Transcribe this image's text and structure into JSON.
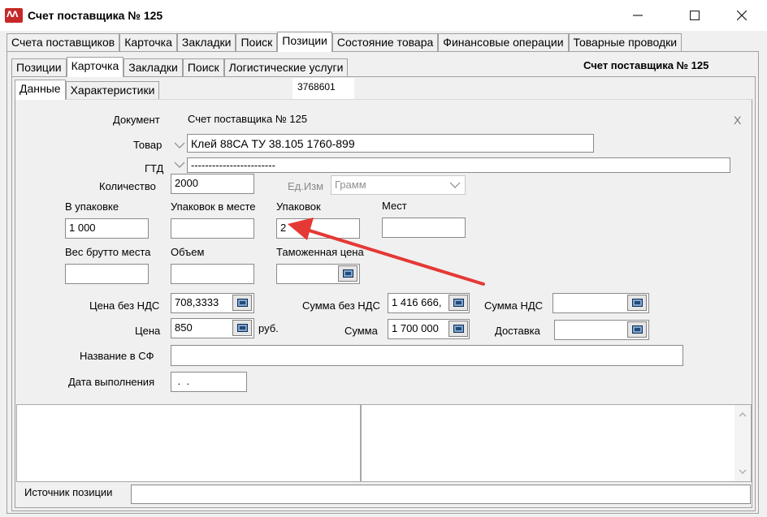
{
  "window": {
    "title": "Счет поставщика № 125",
    "icon_name": "app-logo-icon",
    "controls": [
      "minimize-icon",
      "maximize-icon",
      "close-icon"
    ]
  },
  "main_tabs": [
    {
      "label": "Счета поставщиков"
    },
    {
      "label": "Карточка"
    },
    {
      "label": "Закладки"
    },
    {
      "label": "Поиск"
    },
    {
      "label": "Позиции",
      "active": true
    },
    {
      "label": "Состояние товара"
    },
    {
      "label": "Финансовые операции"
    },
    {
      "label": "Товарные проводки"
    }
  ],
  "sub_tabs": [
    {
      "label": "Позиции"
    },
    {
      "label": "Карточка",
      "active": true
    },
    {
      "label": "Закладки"
    },
    {
      "label": "Поиск"
    },
    {
      "label": "Логистические услуги"
    }
  ],
  "header_doc": "Счет поставщика № 125",
  "inner_tabs": [
    {
      "label": "Данные",
      "active": true
    },
    {
      "label": "Характеристики"
    }
  ],
  "record_id": "3768601",
  "form": {
    "document_label": "Документ",
    "document_value": "Счет поставщика № 125",
    "close_mark": "X",
    "product_label": "Товар",
    "product_value": "Клей 88СА ТУ 38.105 1760-899",
    "gtd_label": "ГТД",
    "gtd_value": "------------------------",
    "quantity_label": "Количество",
    "quantity_value": "2000",
    "unit_label": "Ед.Изм",
    "unit_value": "Грамм",
    "per_pack_label": "В упаковке",
    "per_pack_value": "1 000",
    "packs_per_place_label": "Упаковок в месте",
    "packs_per_place_value": "",
    "packs_label": "Упаковок",
    "packs_value": "2",
    "places_label": "Мест",
    "places_value": "",
    "gross_weight_label": "Вес брутто места",
    "gross_weight_value": "",
    "volume_label": "Объем",
    "volume_value": "",
    "customs_price_label": "Таможенная цена",
    "customs_price_value": "",
    "price_no_vat_label": "Цена без НДС",
    "price_no_vat_value": "708,3333",
    "sum_no_vat_label": "Сумма без НДС",
    "sum_no_vat_value": "1 416 666,",
    "vat_sum_label": "Сумма НДС",
    "vat_sum_value": "",
    "price_label": "Цена",
    "price_value": "850",
    "currency": "руб.",
    "sum_label": "Сумма",
    "sum_value": "1 700 000",
    "delivery_label": "Доставка",
    "delivery_value": "",
    "sf_name_label": "Название в СФ",
    "sf_name_value": "",
    "exec_date_label": "Дата выполнения",
    "exec_date_value": " .  .",
    "source_label": "Источник позиции",
    "source_value": ""
  },
  "annotation_color": "#e53935"
}
